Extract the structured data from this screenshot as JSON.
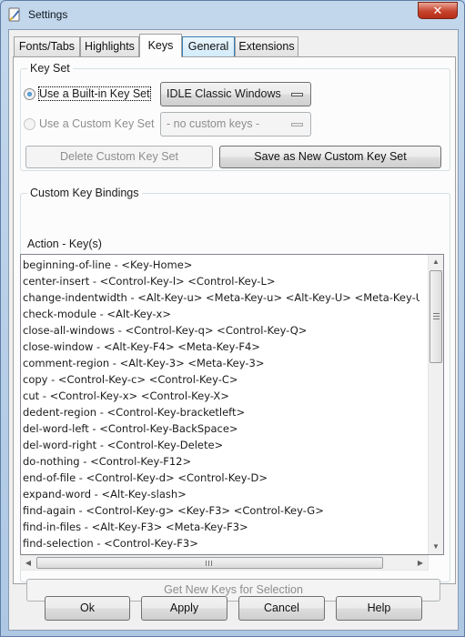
{
  "window": {
    "title": "Settings",
    "close_glyph": "✕"
  },
  "tabs": [
    {
      "label": "Fonts/Tabs"
    },
    {
      "label": "Highlights"
    },
    {
      "label": "Keys"
    },
    {
      "label": "General"
    },
    {
      "label": "Extensions"
    }
  ],
  "key_set": {
    "group_title": "Key Set",
    "builtin_label": "Use a Built-in Key Set",
    "builtin_value": "IDLE Classic Windows",
    "custom_label": "Use a Custom Key Set",
    "custom_value": "- no custom keys -",
    "delete_button": "Delete Custom Key Set",
    "save_button": "Save as New Custom Key Set"
  },
  "custom_bindings": {
    "group_title": "Custom Key Bindings",
    "list_header": "Action - Key(s)",
    "items": [
      "beginning-of-line - <Key-Home>",
      "center-insert - <Control-Key-l> <Control-Key-L>",
      "change-indentwidth - <Alt-Key-u> <Meta-Key-u> <Alt-Key-U> <Meta-Key-U>",
      "check-module - <Alt-Key-x>",
      "close-all-windows - <Control-Key-q> <Control-Key-Q>",
      "close-window - <Alt-Key-F4> <Meta-Key-F4>",
      "comment-region - <Alt-Key-3> <Meta-Key-3>",
      "copy - <Control-Key-c> <Control-Key-C>",
      "cut - <Control-Key-x> <Control-Key-X>",
      "dedent-region - <Control-Key-bracketleft>",
      "del-word-left - <Control-Key-BackSpace>",
      "del-word-right - <Control-Key-Delete>",
      "do-nothing - <Control-Key-F12>",
      "end-of-file - <Control-Key-d> <Control-Key-D>",
      "expand-word - <Alt-Key-slash>",
      "find-again - <Control-Key-g> <Key-F3> <Control-Key-G>",
      "find-in-files - <Alt-Key-F3> <Meta-Key-F3>",
      "find-selection - <Control-Key-F3>"
    ],
    "get_keys_button": "Get New Keys for Selection"
  },
  "dialog_buttons": {
    "ok": "Ok",
    "apply": "Apply",
    "cancel": "Cancel",
    "help": "Help"
  },
  "icons": {
    "app": "idle-feather-icon",
    "scroll_up": "▲",
    "scroll_down": "▼",
    "scroll_left": "◀",
    "scroll_right": "▶"
  }
}
